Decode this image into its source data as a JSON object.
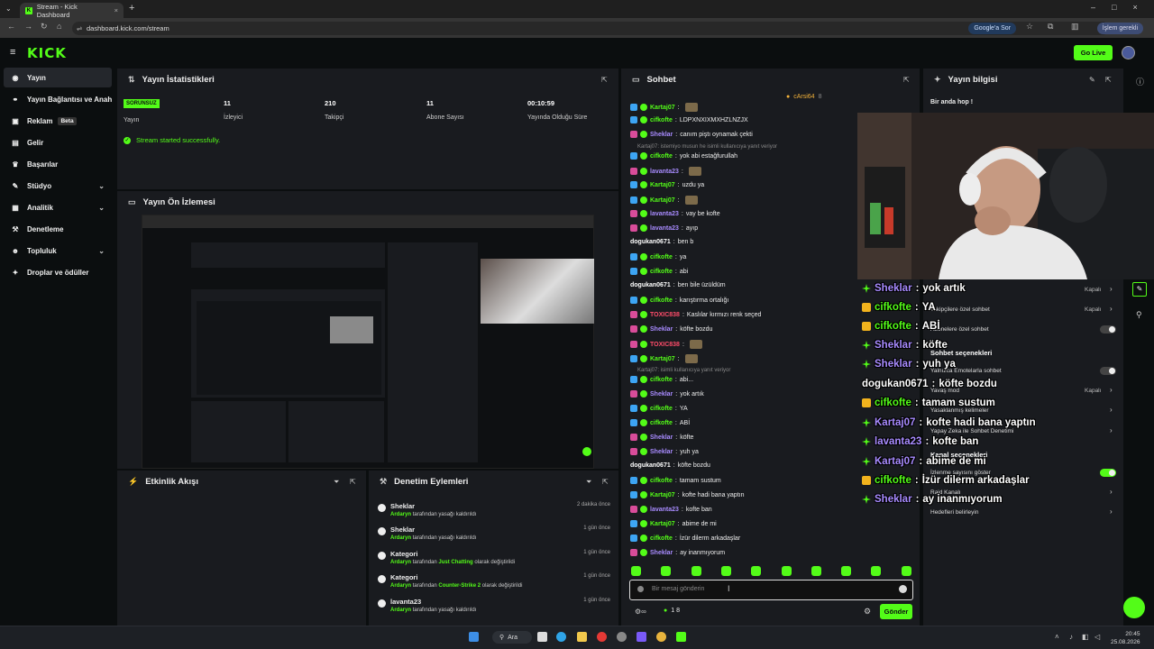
{
  "browser": {
    "tab_title": "Stream - Kick Dashboard",
    "url": "dashboard.kick.com/stream",
    "google_pill": "Google'a Sor",
    "profile_pill": "İşlem gerekli"
  },
  "app": {
    "logo": "KICK",
    "go_live": "Go Live"
  },
  "sidebar": {
    "items": [
      {
        "label": "Yayın"
      },
      {
        "label": "Yayın Bağlantısı ve Anahtarı"
      },
      {
        "label": "Reklam",
        "badge": "Beta"
      },
      {
        "label": "Gelir"
      },
      {
        "label": "Başarılar"
      },
      {
        "label": "Stüdyo"
      },
      {
        "label": "Analitik"
      },
      {
        "label": "Denetleme"
      },
      {
        "label": "Topluluk"
      },
      {
        "label": "Droplar ve ödüller"
      }
    ]
  },
  "stats": {
    "title": "Yayın İstatistikleri",
    "status_badge": "SORUNSUZ",
    "status_label": "Yayın",
    "viewers_value": "11",
    "viewers_label": "İzleyici",
    "followers_value": "210",
    "followers_label": "Takipçi",
    "subs_value": "11",
    "subs_label": "Abone Sayısı",
    "uptime_value": "00:10:59",
    "uptime_label": "Yayında Olduğu Süre",
    "success_msg": "Stream started successfully."
  },
  "preview": {
    "title": "Yayın Ön İzlemesi"
  },
  "activity": {
    "title": "Etkinlik Akışı"
  },
  "moderation": {
    "title": "Denetim Eylemleri",
    "rows": [
      {
        "target": "Sheklar",
        "actor": "Ardaryn",
        "action": "tarafından yasağı kaldırıldı",
        "time": "2 dakika önce"
      },
      {
        "target": "Sheklar",
        "actor": "Ardaryn",
        "action": "tarafından yasağı kaldırıldı",
        "time": "1 gün önce"
      },
      {
        "target": "Kategori",
        "actor": "Ardaryn",
        "action": "tarafından",
        "cat": "Just Chatting",
        "suffix": "olarak değiştirildi",
        "time": "1 gün önce"
      },
      {
        "target": "Kategori",
        "actor": "Ardaryn",
        "action": "tarafından",
        "cat": "Counter-Strike 2",
        "suffix": "olarak değiştirildi",
        "time": "1 gün önce"
      },
      {
        "target": "lavanta23",
        "actor": "Ardaryn",
        "action": "tarafından yasağı kaldırıldı",
        "time": "1 gün önce"
      }
    ]
  },
  "chat": {
    "title": "Sohbet",
    "pinned_user": "cArsi64",
    "pinned_count": "8",
    "input_placeholder": "Bir mesaj gönderin",
    "send_label": "Gönder",
    "viewer_count": "1 8",
    "reply_note_1": "Kartaj07: istemiyo musun he isimli kullanıcıya yanıt veriyor",
    "reply_note_2": "Kartaj07: isimli kullanıcıya yanıt veriyor",
    "messages": [
      {
        "user": "Kartaj07",
        "text": "",
        "color": "#53fc18"
      },
      {
        "user": "cifkofte",
        "text": "LDPXNXIXMXHZLNZJX",
        "color": "#53fc18"
      },
      {
        "user": "Sheklar",
        "text": "canım piştı oynamak çekti",
        "color": "#a88bff"
      },
      {
        "user": "cifkofte",
        "text": "yok abi estağfurullah",
        "color": "#53fc18"
      },
      {
        "user": "lavanta23",
        "text": "",
        "color": "#a88bff"
      },
      {
        "user": "Kartaj07",
        "text": "uzdu ya",
        "color": "#53fc18"
      },
      {
        "user": "Kartaj07",
        "text": "",
        "color": "#53fc18"
      },
      {
        "user": "lavanta23",
        "text": "vay be kofte",
        "color": "#a88bff"
      },
      {
        "user": "lavanta23",
        "text": "ayıp",
        "color": "#a88bff"
      },
      {
        "user": "dogukan0671",
        "text": "ben b",
        "color": "#ffffff"
      },
      {
        "user": "cifkofte",
        "text": "ya",
        "color": "#53fc18"
      },
      {
        "user": "cifkofte",
        "text": "abi",
        "color": "#53fc18"
      },
      {
        "user": "dogukan0671",
        "text": "ben bile üzüldüm",
        "color": "#ffffff"
      },
      {
        "user": "cifkofte",
        "text": "karıştırma ortalığı",
        "color": "#53fc18"
      },
      {
        "user": "TOXIC838",
        "text": "Kaslılar kırmızı renk seçed",
        "color": "#ff4c6a"
      },
      {
        "user": "Sheklar",
        "text": "köfte bozdu",
        "color": "#a88bff"
      },
      {
        "user": "TOXIC838",
        "text": "",
        "color": "#ff4c6a"
      },
      {
        "user": "Kartaj07",
        "text": "",
        "color": "#53fc18"
      },
      {
        "user": "cifkofte",
        "text": "abi...",
        "color": "#53fc18"
      },
      {
        "user": "Sheklar",
        "text": "yok artık",
        "color": "#a88bff"
      },
      {
        "user": "cifkofte",
        "text": "YA",
        "color": "#53fc18"
      },
      {
        "user": "cifkofte",
        "text": "ABİ",
        "color": "#53fc18"
      },
      {
        "user": "Sheklar",
        "text": "köfte",
        "color": "#a88bff"
      },
      {
        "user": "Sheklar",
        "text": "yuh ya",
        "color": "#a88bff"
      },
      {
        "user": "dogukan0671",
        "text": "köfte bozdu",
        "color": "#ffffff"
      },
      {
        "user": "cifkofte",
        "text": "tamam sustum",
        "color": "#53fc18"
      },
      {
        "user": "Kartaj07",
        "text": "kofte hadi bana yaptın",
        "color": "#53fc18"
      },
      {
        "user": "lavanta23",
        "text": "kofte ban",
        "color": "#a88bff"
      },
      {
        "user": "Kartaj07",
        "text": "abime de mi",
        "color": "#53fc18"
      },
      {
        "user": "cifkofte",
        "text": "İzür dilerm arkadaşlar",
        "color": "#53fc18"
      },
      {
        "user": "Sheklar",
        "text": "ay inanmıyorum",
        "color": "#a88bff"
      }
    ]
  },
  "info": {
    "title": "Yayın bilgisi",
    "stream_title": "Bir anda hop !"
  },
  "overlay": {
    "lines": [
      {
        "user": "Sheklar",
        "text": "yok artık",
        "color": "#a88bff"
      },
      {
        "user": "cifkofte",
        "text": "YA",
        "color": "#53fc18"
      },
      {
        "user": "cifkofte",
        "text": "ABİ",
        "color": "#53fc18"
      },
      {
        "user": "Sheklar",
        "text": "köfte",
        "color": "#a88bff"
      },
      {
        "user": "Sheklar",
        "text": "yuh ya",
        "color": "#a88bff"
      },
      {
        "user": "dogukan0671",
        "text": "köfte bozdu",
        "color": "#ffffff"
      },
      {
        "user": "cifkofte",
        "text": "tamam sustum",
        "color": "#53fc18"
      },
      {
        "user": "Kartaj07",
        "text": "kofte hadi bana yaptın",
        "color": "#a88bff"
      },
      {
        "user": "lavanta23",
        "text": "kofte ban",
        "color": "#a88bff"
      },
      {
        "user": "Kartaj07",
        "text": "abime de mi",
        "color": "#a88bff"
      },
      {
        "user": "cifkofte",
        "text": "İzür dilerm arkadaşlar",
        "color": "#53fc18"
      },
      {
        "user": "Sheklar",
        "text": "ay inanmıyorum",
        "color": "#a88bff"
      }
    ]
  },
  "settings": {
    "rows": [
      {
        "label": "Takipçilere özel sohbet",
        "value": "Kapalı"
      },
      {
        "label": "Abonelere özel sohbet",
        "value": "toggle-off"
      },
      {
        "label": "Sohbet seçenekleri",
        "value": ""
      },
      {
        "label": "Yalnızca Emotelarla sohbet",
        "value": "toggle-off"
      },
      {
        "label": "Yavaş mod",
        "value": "Kapalı"
      },
      {
        "label": "Yasaklanmış kelimeler",
        "value": ""
      },
      {
        "label": "Yapay Zeka ile Sohbet Denetimi",
        "value": ""
      },
      {
        "label": "Kanal seçenekleri",
        "value": ""
      },
      {
        "label": "İzlenme sayısını göster",
        "value": "toggle-on"
      },
      {
        "label": "Raid Kanalı",
        "value": ""
      },
      {
        "label": "Hedefleri belirleyin",
        "value": ""
      }
    ],
    "top_value": "Kapalı"
  },
  "taskbar": {
    "search": "Ara",
    "time": "20:45",
    "date": "25.08.2026"
  },
  "colors": {
    "brand": "#53fc18",
    "panel": "#191b1f",
    "bg": "#0b0e0f"
  }
}
